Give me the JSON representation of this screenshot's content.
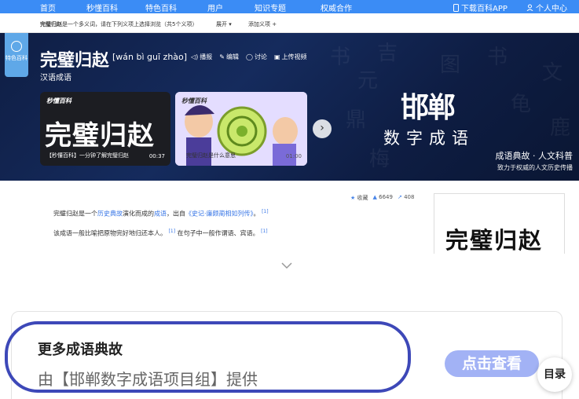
{
  "nav": {
    "items": [
      "首页",
      "秒懂百科",
      "特色百科",
      "用户",
      "知识专题",
      "权威合作"
    ],
    "download_app": "下载百科APP",
    "user_center": "个人中心"
  },
  "subbar": {
    "term": "完璧归赵",
    "notice": "是一个多义词，请在下列义项上选择浏览（共5个义项）",
    "expand": "展开",
    "add_meaning": "添加义项"
  },
  "header": {
    "badge_label": "特色百科",
    "title": "完璧归赵",
    "pinyin": "[wán bì guī zhào]",
    "actions": {
      "play": "播报",
      "edit": "编辑",
      "discuss": "讨论",
      "upload_video": "上传视频"
    },
    "subtitle": "汉语成语"
  },
  "videos": [
    {
      "logo": "秒懂百科",
      "big_text": "完璧归赵",
      "caption": "【秒懂百科】一分钟了解完璧归赵",
      "duration": "00:37"
    },
    {
      "logo": "秒懂百科",
      "caption": "完璧归赵是什么意思",
      "duration": "01:00"
    }
  ],
  "brand": {
    "logo": "邯郸",
    "subtitle": "数字成语",
    "slogan": "成语典故 · 人文科普",
    "slogan2": "致力于权威的人文历史传播"
  },
  "content": {
    "p1_a": "完璧归赵是一个",
    "p1_link1": "历史典故",
    "p1_b": "演化而成的",
    "p1_link2": "成语",
    "p1_c": "，出自",
    "p1_link3": "《史记·廉颇蔺相如列传》",
    "p1_d": "。",
    "p1_ref": "[1]",
    "p2_a": "该成语一般比喻把原物完好地归还本人。",
    "p2_ref1": "[1]",
    "p2_b": "在句子中一般作谓语、宾语。",
    "p2_ref2": "[1]",
    "stats": {
      "collect": "收藏",
      "likes": "6649",
      "shares": "408"
    },
    "calligraphy": "完璧归赵"
  },
  "bottom": {
    "title": "更多成语典故",
    "provider": "由【邯郸数字成语项目组】提供",
    "view_button": "点击查看",
    "toc_button": "目录"
  }
}
